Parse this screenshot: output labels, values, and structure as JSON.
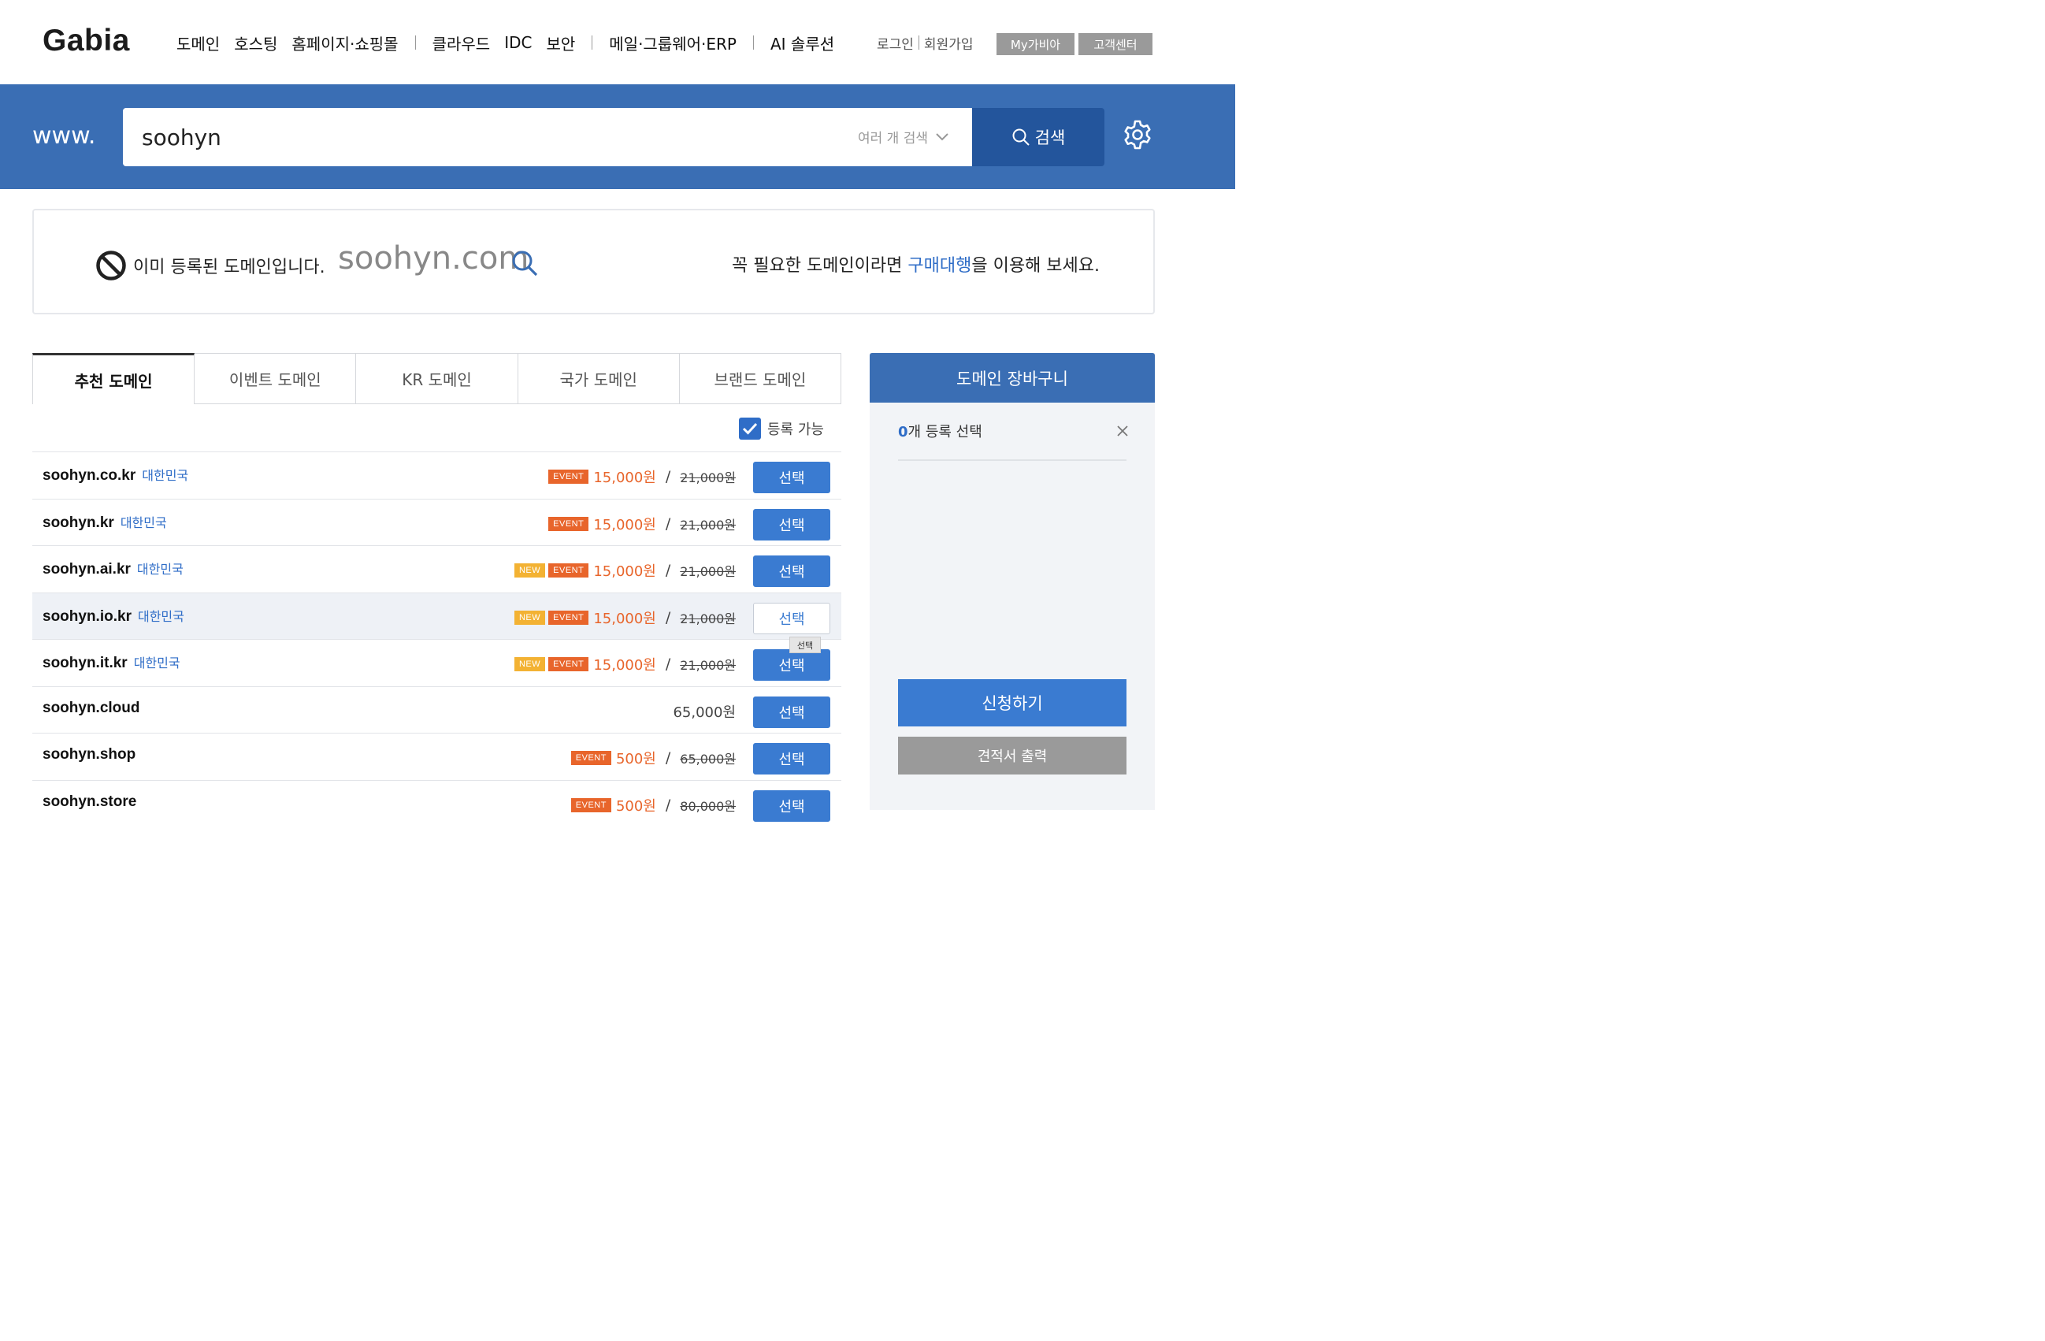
{
  "header": {
    "logo": "Gabia",
    "nav": [
      "도메인",
      "호스팅",
      "홈페이지·쇼핑몰",
      "클라우드",
      "IDC",
      "보안",
      "메일·그룹웨어·ERP",
      "AI 솔루션"
    ],
    "login": "로그인",
    "signup": "회원가입",
    "my_gabia": "My가비아",
    "support": "고객센터"
  },
  "search": {
    "prefix": "www.",
    "value": "soohyn",
    "multi_label": "여러 개 검색",
    "button_label": "검색"
  },
  "notice": {
    "message": "이미 등록된 도메인입니다.",
    "domain": "soohyn.com",
    "right_before": "꼭 필요한 도메인이라면 ",
    "right_link": "구매대행",
    "right_after": "을 이용해 보세요."
  },
  "tabs": [
    "추천 도메인",
    "이벤트 도메인",
    "KR 도메인",
    "국가 도메인",
    "브랜드 도메인"
  ],
  "filter": {
    "label": "등록 가능",
    "checked": true
  },
  "badges": {
    "new": "NEW",
    "event": "EVENT"
  },
  "rows": [
    {
      "domain": "soohyn.co.kr",
      "country": "대한민국",
      "price": "15,000원",
      "slash": "/",
      "original": "21,000원",
      "select": "선택"
    },
    {
      "domain": "soohyn.kr",
      "country": "대한민국",
      "price": "15,000원",
      "slash": "/",
      "original": "21,000원",
      "select": "선택"
    },
    {
      "domain": "soohyn.ai.kr",
      "country": "대한민국",
      "price": "15,000원",
      "slash": "/",
      "original": "21,000원",
      "select": "선택"
    },
    {
      "domain": "soohyn.io.kr",
      "country": "대한민국",
      "price": "15,000원",
      "slash": "/",
      "original": "21,000원",
      "select": "선택"
    },
    {
      "domain": "soohyn.it.kr",
      "country": "대한민국",
      "price": "15,000원",
      "slash": "/",
      "original": "21,000원",
      "select": "선택"
    },
    {
      "domain": "soohyn.cloud",
      "country": "",
      "price": "65,000원",
      "slash": "",
      "original": "",
      "select": "선택"
    },
    {
      "domain": "soohyn.shop",
      "country": "",
      "price": "500원",
      "slash": "/",
      "original": "65,000원",
      "select": "선택"
    },
    {
      "domain": "soohyn.store",
      "country": "",
      "price": "500원",
      "slash": "/",
      "original": "80,000원",
      "select": "선택"
    }
  ],
  "tooltip": "선택",
  "cart": {
    "title": "도메인 장바구니",
    "count": "0",
    "count_suffix": "개 등록 선택",
    "apply": "신청하기",
    "quote": "견적서 출력"
  },
  "colors": {
    "primary": "#3a6eb4",
    "dark_primary": "#23559c",
    "event": "#e8652b",
    "new": "#f3b233",
    "link": "#2f6dc7"
  }
}
